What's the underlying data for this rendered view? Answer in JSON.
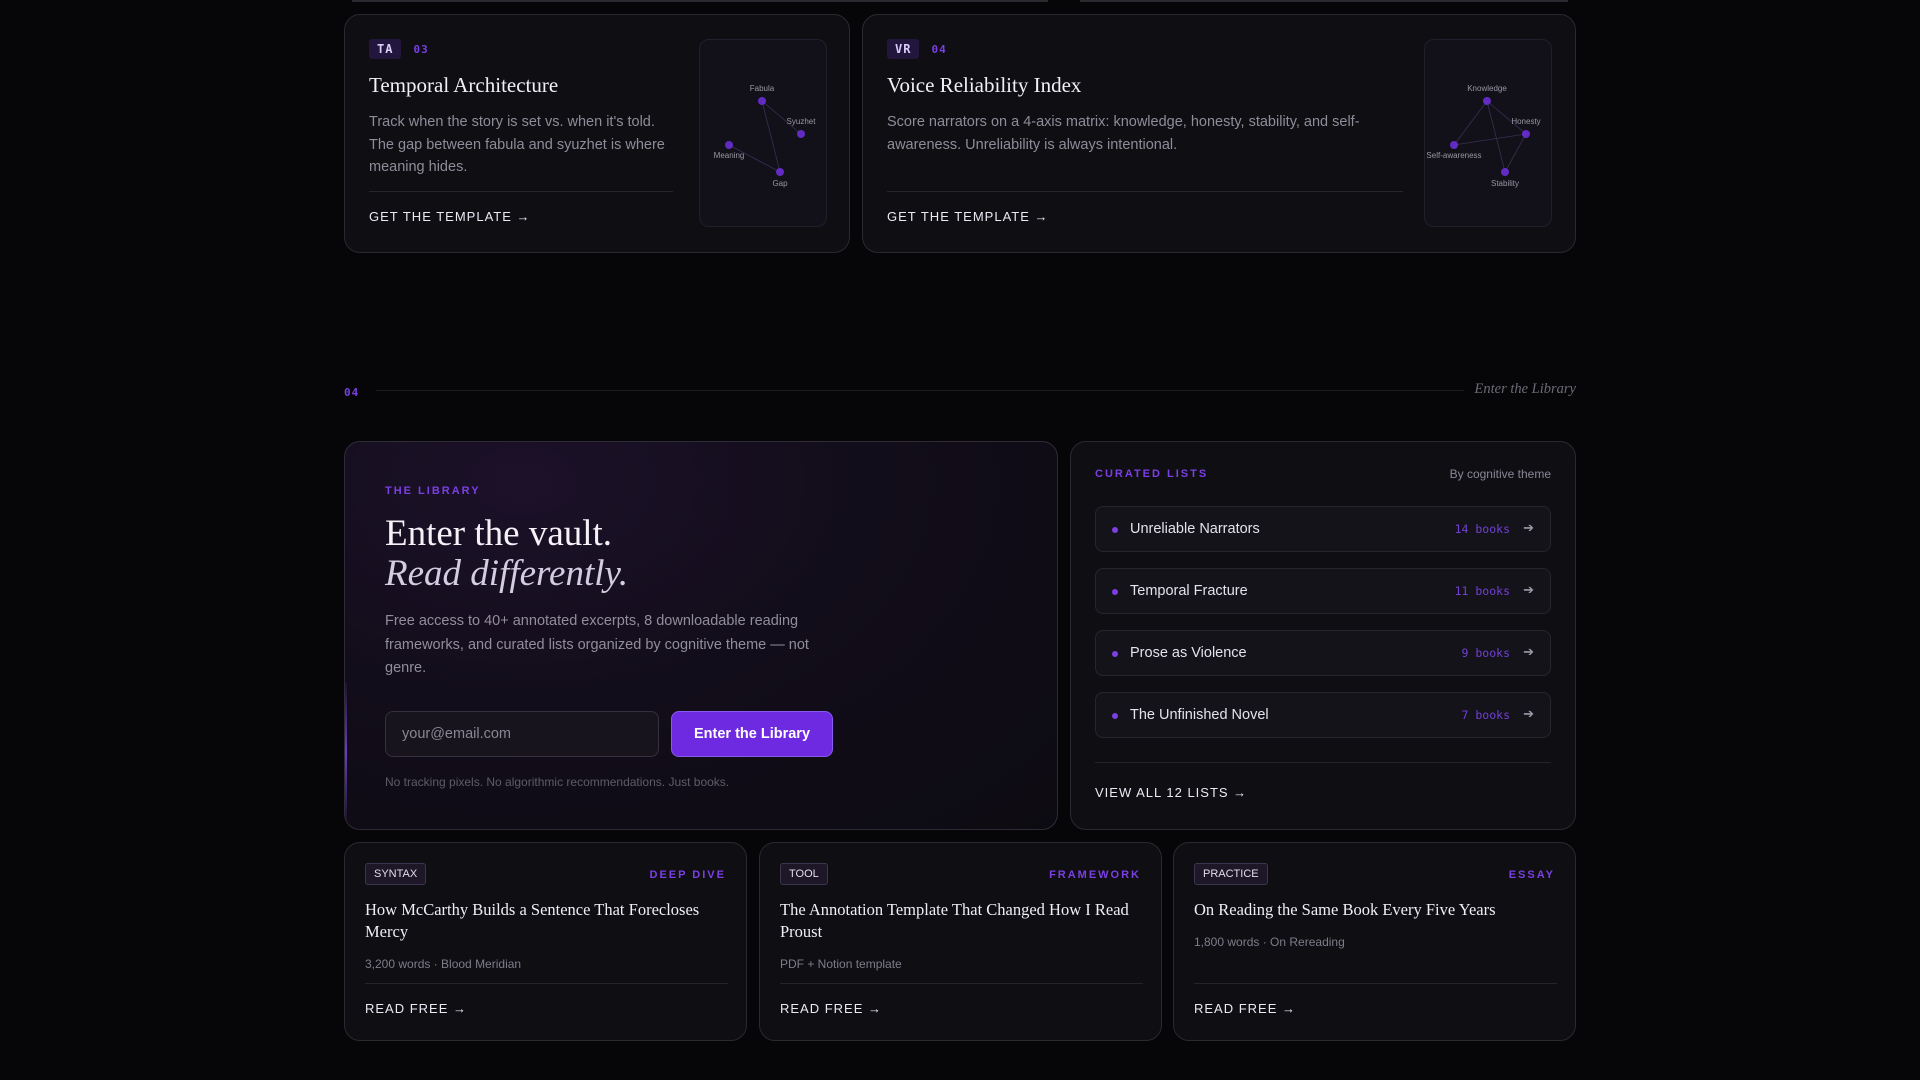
{
  "frameworks": [
    {
      "abbr": "TA",
      "number": "03",
      "title": "Temporal Architecture",
      "description": "Track when the story is set vs. when it's told. The gap between fabula and syuzhet is where meaning hides.",
      "link": "GET THE TEMPLATE →",
      "graph_nodes": [
        "Fabula",
        "Syuzhet",
        "Meaning",
        "Gap"
      ]
    },
    {
      "abbr": "VR",
      "number": "04",
      "title": "Voice Reliability Index",
      "description": "Score narrators on a 4-axis matrix: knowledge, honesty, stability, and self-awareness. Unreliability is always intentional.",
      "link": "GET THE TEMPLATE →",
      "graph_nodes": [
        "Knowledge",
        "Honesty",
        "Self-awareness",
        "Stability"
      ]
    }
  ],
  "section": {
    "number": "04",
    "label": "Enter the Library"
  },
  "library": {
    "eyebrow": "THE LIBRARY",
    "heading": "Enter the vault.",
    "heading_italic": "Read differently.",
    "description": "Free access to 40+ annotated excerpts, 8 downloadable reading frameworks, and curated lists organized by cognitive theme — not genre.",
    "email_placeholder": "your@email.com",
    "button_label": "Enter the Library",
    "note": "No tracking pixels. No algorithmic recommendations. Just books."
  },
  "curated": {
    "eyebrow": "CURATED LISTS",
    "subtitle": "By cognitive theme",
    "items": [
      {
        "name": "Unreliable Narrators",
        "count": "14 books"
      },
      {
        "name": "Temporal Fracture",
        "count": "11 books"
      },
      {
        "name": "Prose as Violence",
        "count": "9 books"
      },
      {
        "name": "The Unfinished Novel",
        "count": "7 books"
      }
    ],
    "view_all": "VIEW ALL 12 LISTS →"
  },
  "articles": [
    {
      "tag": "SYNTAX",
      "type": "DEEP DIVE",
      "title": "How McCarthy Builds a Sentence That Forecloses Mercy",
      "meta": "3,200 words · Blood Meridian",
      "link": "READ FREE →"
    },
    {
      "tag": "TOOL",
      "type": "FRAMEWORK",
      "title": "The Annotation Template That Changed How I Read Proust",
      "meta": "PDF + Notion template",
      "link": "READ FREE →"
    },
    {
      "tag": "PRACTICE",
      "type": "ESSAY",
      "title": "On Reading the Same Book Every Five Years",
      "meta": "1,800 words · On Rereading",
      "link": "READ FREE →"
    }
  ],
  "colors": {
    "accent": "#7b3fe4",
    "button": "#6d2ae0",
    "background": "#060608",
    "card": "#0f0e13"
  }
}
